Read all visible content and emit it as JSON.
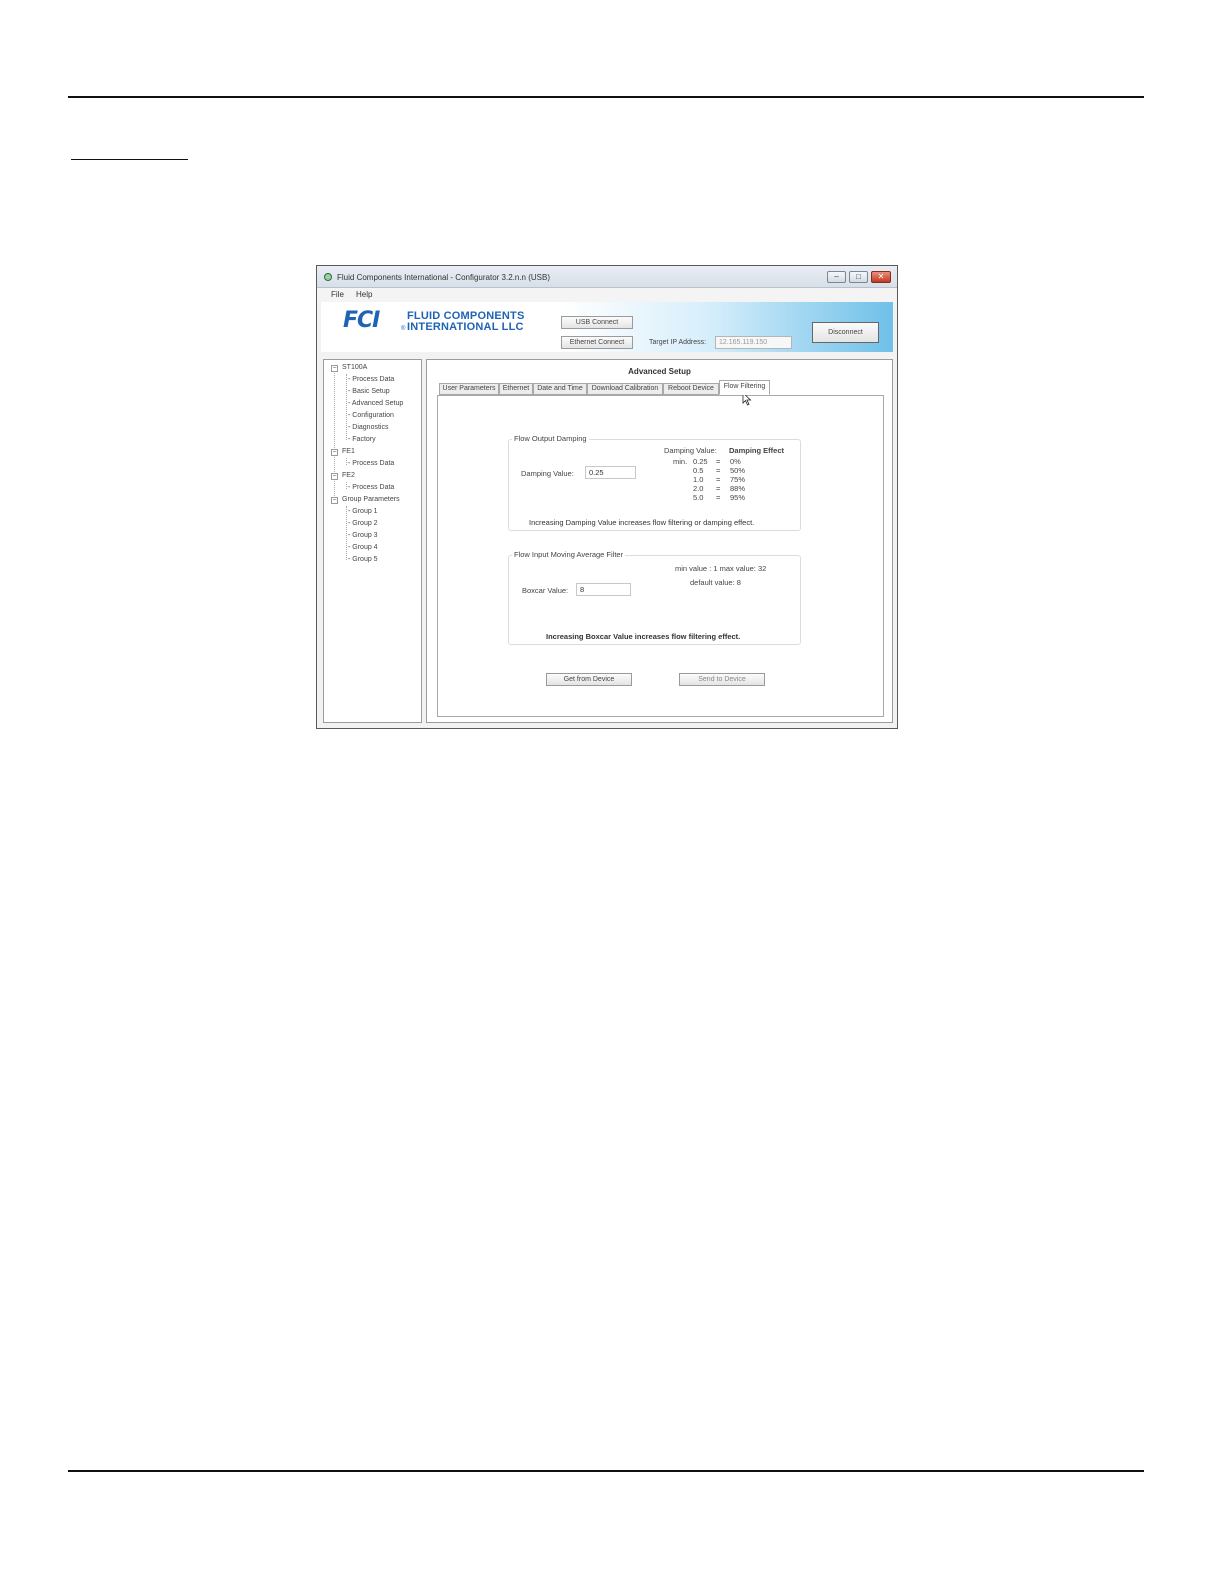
{
  "window": {
    "title": "Fluid Components International - Configurator 3.2.n.n (USB)",
    "controls": {
      "minimize": "–",
      "maximize": "□",
      "close": "✕"
    }
  },
  "menu": [
    "File",
    "Help"
  ],
  "logo": {
    "mark": "FCI",
    "line1": "FLUID COMPONENTS",
    "line2": "INTERNATIONAL LLC",
    "registered": "®"
  },
  "connection": {
    "usb_connect": "USB Connect",
    "ethernet_connect": "Ethernet Connect",
    "target_ip_label": "Target IP Address:",
    "target_ip_value": "12.165.119.150",
    "disconnect": "Disconnect"
  },
  "tree": {
    "nodes": [
      {
        "label": "ST100A",
        "children": [
          "Process Data",
          "Basic Setup",
          "Advanced Setup",
          "Configuration",
          "Diagnostics",
          "Factory"
        ]
      },
      {
        "label": "FE1",
        "children": [
          "Process Data"
        ]
      },
      {
        "label": "FE2",
        "children": [
          "Process Data"
        ]
      },
      {
        "label": "Group Parameters",
        "children": [
          "Group 1",
          "Group 2",
          "Group 3",
          "Group 4",
          "Group 5"
        ]
      }
    ]
  },
  "content": {
    "title": "Advanced Setup",
    "tabs": [
      "User Parameters",
      "Ethernet",
      "Date and Time",
      "Download Calibration",
      "Reboot Device",
      "Flow Filtering"
    ],
    "active_tab": "Flow Filtering"
  },
  "damping": {
    "group_title": "Flow Output Damping",
    "label": "Damping Value:",
    "value": "0.25",
    "table_header_value": "Damping Value:",
    "table_header_effect": "Damping Effect",
    "min_prefix": "min.",
    "rows": [
      {
        "value": "0.25",
        "sep": "=",
        "effect": "0%"
      },
      {
        "value": "0.5",
        "sep": "=",
        "effect": "50%"
      },
      {
        "value": "1.0",
        "sep": "=",
        "effect": "75%"
      },
      {
        "value": "2.0",
        "sep": "=",
        "effect": "88%"
      },
      {
        "value": "5.0",
        "sep": "=",
        "effect": "95%"
      }
    ],
    "note": "Increasing Damping Value increases flow filtering or damping effect."
  },
  "boxcar": {
    "group_title": "Flow Input Moving Average Filter",
    "label": "Boxcar Value:",
    "value": "8",
    "range": "min value : 1  max value: 32",
    "default": "default value: 8",
    "note": "Increasing Boxcar Value increases flow filtering effect."
  },
  "actions": {
    "get": "Get from Device",
    "send": "Send to Device"
  }
}
